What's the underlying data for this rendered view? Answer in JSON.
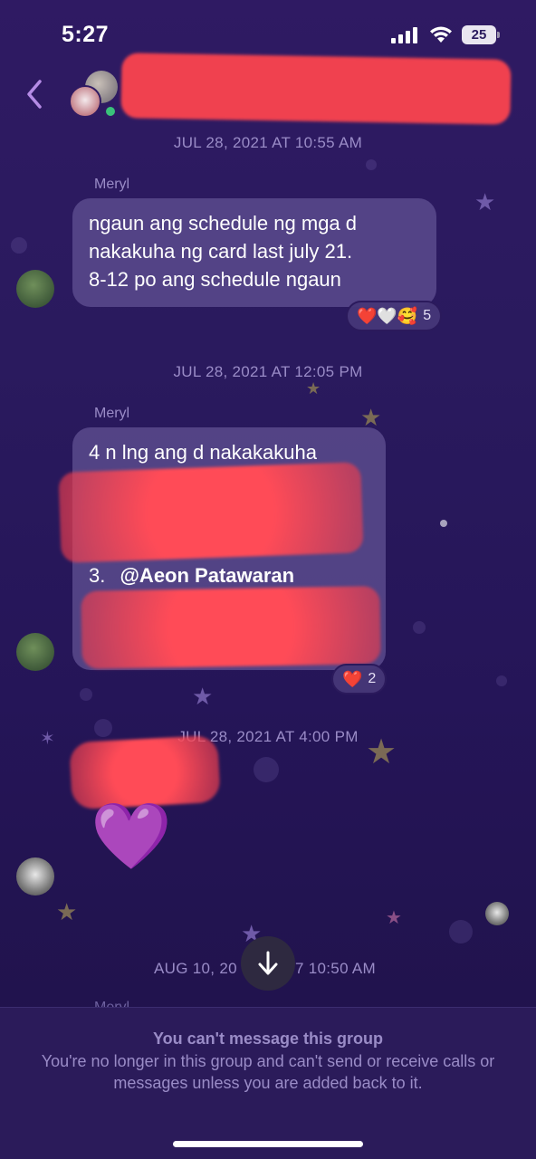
{
  "status_bar": {
    "time": "5:27",
    "battery": "25"
  },
  "header": {
    "back_icon": "chevron-left-icon"
  },
  "timestamps": [
    "JUL 28, 2021 AT 10:55 AM",
    "JUL 28, 2021 AT 12:05 PM",
    "JUL 28, 2021 AT 4:00 PM",
    "AUG 10, 20",
    "7 10:50 AM"
  ],
  "messages": [
    {
      "sender": "Meryl",
      "lines": [
        "ngaun ang schedule ng mga d",
        "nakakuha ng card last july 21.",
        "8-12 po ang schedule ngaun"
      ],
      "reactions": {
        "emojis": "❤️🤍🥰",
        "count": "5"
      }
    },
    {
      "sender": "Meryl",
      "lines": [
        "4 n lng ang d nakakakuha"
      ],
      "list_item_3": "3.",
      "mention": "@Aeon Patawaran",
      "reactions": {
        "emojis": "❤️",
        "count": "2"
      }
    },
    {
      "emoji": "💜"
    }
  ],
  "peek_sender": "Meryl",
  "footer": {
    "title": "You can't message this group",
    "text": "You're no longer in this group and can't send or receive calls or messages unless you are added back to it."
  },
  "colors": {
    "background": "#2a1a5e",
    "bubble": "#5f5091",
    "meta_text": "#9a8cc7",
    "redaction": "#f0414f"
  }
}
